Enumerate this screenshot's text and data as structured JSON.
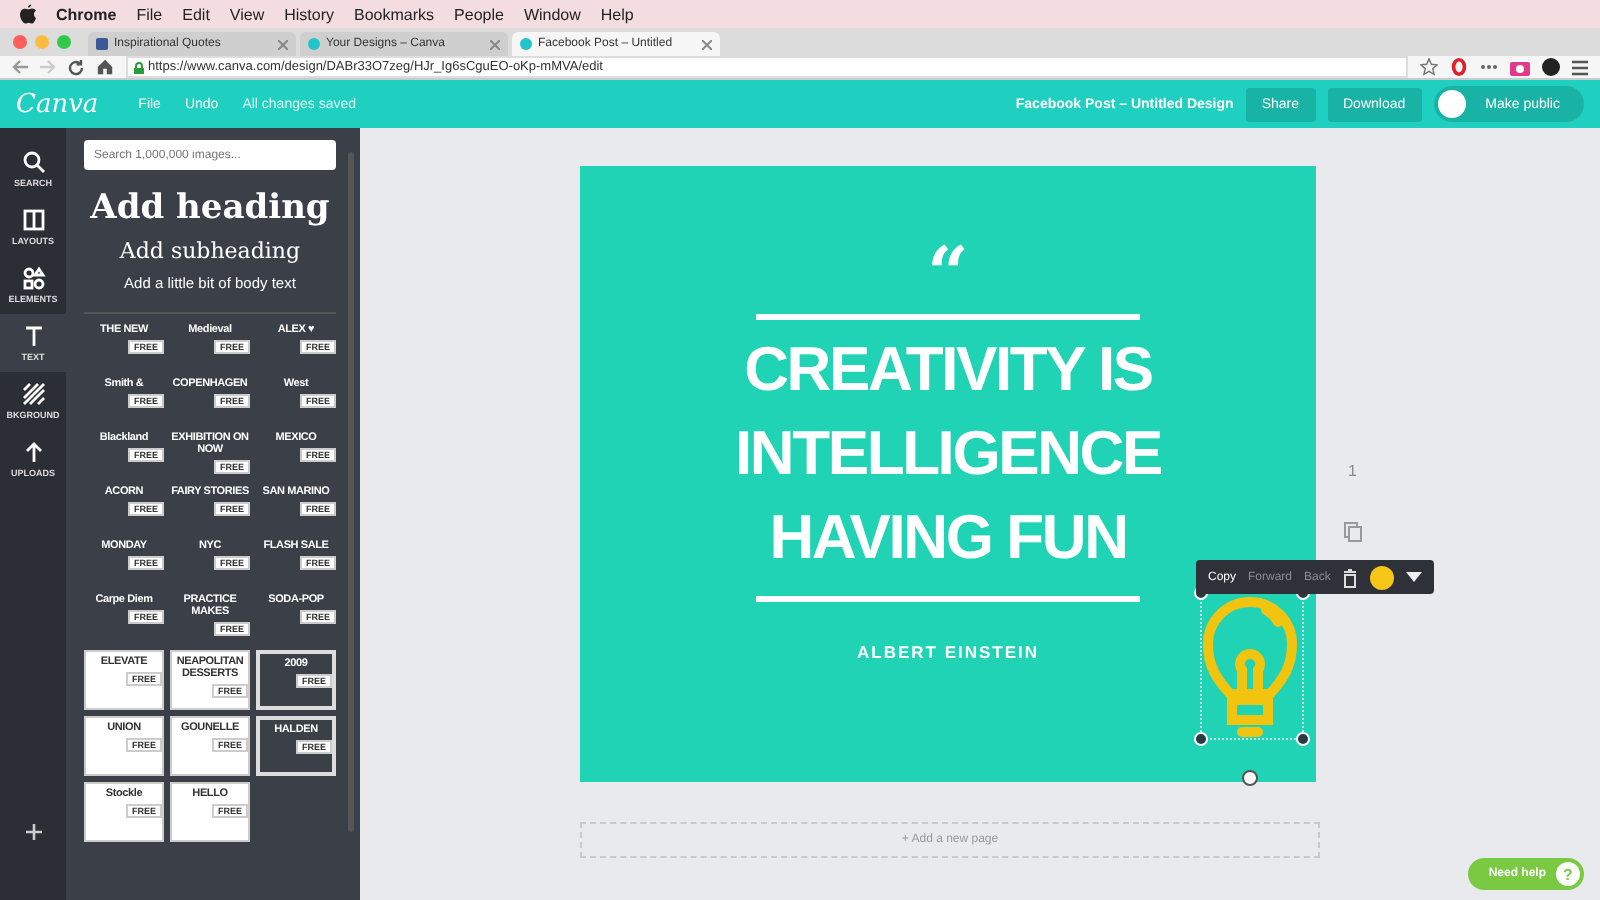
{
  "menu_bar": {
    "app": "Chrome",
    "items": [
      "File",
      "Edit",
      "View",
      "History",
      "Bookmarks",
      "People",
      "Window",
      "Help"
    ]
  },
  "tabs": [
    {
      "title": "Inspirational Quotes",
      "selected": false
    },
    {
      "title": "Your Designs – Canva",
      "selected": false
    },
    {
      "title": "Facebook Post – Untitled",
      "selected": true
    }
  ],
  "address_bar": {
    "url": "https://www.canva.com/design/DABr33O7zeg/HJr_Ig6sCguEO-oKp-mMVA/edit"
  },
  "header": {
    "logo": "Canva",
    "menu": [
      "File",
      "Undo"
    ],
    "status": "All changes saved",
    "design_title": "Facebook Post – Untitled Design",
    "buttons": [
      "Share",
      "Download"
    ],
    "public_toggle": {
      "label": "Make public",
      "on": false
    }
  },
  "rail": [
    {
      "label": "SEARCH",
      "selected": false
    },
    {
      "label": "LAYOUTS",
      "selected": false
    },
    {
      "label": "ELEMENTS",
      "selected": false
    },
    {
      "label": "TEXT",
      "selected": true
    },
    {
      "label": "BKGROUND",
      "selected": false
    },
    {
      "label": "UPLOADS",
      "selected": false
    }
  ],
  "panel": {
    "search": {
      "placeholder": "Search 1,000,000 images..."
    },
    "heading": "Add heading",
    "subheading": "Add subheading",
    "body_text": "Add a little bit of body text",
    "templates": [
      {
        "text": "THE NEW",
        "kind": "dark",
        "badge": "FREE"
      },
      {
        "text": "Medieval",
        "kind": "dark",
        "badge": "FREE"
      },
      {
        "text": "ALEX ♥",
        "kind": "dark",
        "badge": "FREE"
      },
      {
        "text": "Smith &",
        "kind": "dark",
        "badge": "FREE"
      },
      {
        "text": "COPENHAGEN",
        "kind": "dark",
        "badge": "FREE"
      },
      {
        "text": "West",
        "kind": "dark",
        "badge": "FREE"
      },
      {
        "text": "Blackland",
        "kind": "dark",
        "badge": "FREE"
      },
      {
        "text": "EXHIBITION ON NOW",
        "kind": "dark",
        "badge": "FREE"
      },
      {
        "text": "MEXICO",
        "kind": "dark",
        "badge": "FREE"
      },
      {
        "text": "ACORN",
        "kind": "dark",
        "badge": "FREE"
      },
      {
        "text": "FAIRY STORIES",
        "kind": "dark",
        "badge": "FREE"
      },
      {
        "text": "SAN MARINO",
        "kind": "dark",
        "badge": "FREE"
      },
      {
        "text": "MONDAY",
        "kind": "dark",
        "badge": "FREE"
      },
      {
        "text": "NYC",
        "kind": "dark",
        "badge": "FREE"
      },
      {
        "text": "FLASH SALE",
        "kind": "dark",
        "badge": "FREE"
      },
      {
        "text": "Carpe Diem",
        "kind": "dark",
        "badge": "FREE"
      },
      {
        "text": "PRACTICE MAKES",
        "kind": "dark",
        "badge": "FREE"
      },
      {
        "text": "SODA-POP",
        "kind": "dark",
        "badge": "FREE"
      },
      {
        "text": "ELEVATE",
        "kind": "light",
        "badge": "FREE"
      },
      {
        "text": "NEAPOLITAN DESSERTS",
        "kind": "light",
        "badge": "FREE"
      },
      {
        "text": "2009",
        "kind": "boxed",
        "badge": "FREE"
      },
      {
        "text": "UNION",
        "kind": "light",
        "badge": "FREE"
      },
      {
        "text": "GOUNELLE",
        "kind": "light",
        "badge": "FREE"
      },
      {
        "text": "HALDEN",
        "kind": "boxed",
        "badge": "FREE"
      },
      {
        "text": "Stockle",
        "kind": "light",
        "badge": "FREE"
      },
      {
        "text": "HELLO",
        "kind": "light",
        "badge": "FREE"
      }
    ]
  },
  "design": {
    "quote_mark": "“",
    "headline": "CREATIVITY IS INTELLIGENCE HAVING FUN",
    "author": "ALBERT EINSTEIN"
  },
  "element_toolbar": {
    "actions": [
      {
        "label": "Copy",
        "disabled": false
      },
      {
        "label": "Forward",
        "disabled": true
      },
      {
        "label": "Back",
        "disabled": true
      }
    ],
    "color": "#f5c518"
  },
  "page_number": "1",
  "add_page": "+ Add a new page",
  "help_button": {
    "label": "Need help",
    "icon": "?"
  }
}
